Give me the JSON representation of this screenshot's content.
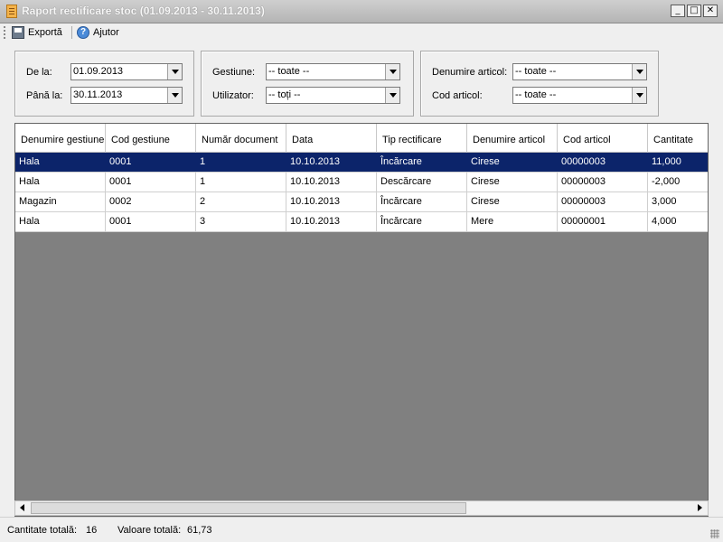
{
  "window": {
    "title": "Raport rectificare stoc (01.09.2013 - 30.11.2013)",
    "minimize_glyph": "_",
    "maximize_glyph": "□",
    "close_glyph": "✕"
  },
  "toolbar": {
    "export_label": "Exportă",
    "export_icon": "save-icon",
    "help_label": "Ajutor",
    "help_icon": "help-icon"
  },
  "filters": {
    "from_label": "De la:",
    "from_value": "01.09.2013",
    "to_label": "Până la:",
    "to_value": "30.11.2013",
    "gestiune_label": "Gestiune:",
    "gestiune_value": "-- toate --",
    "user_label": "Utilizator:",
    "user_value": "-- toți --",
    "article_name_label": "Denumire articol:",
    "article_name_value": "-- toate --",
    "article_code_label": "Cod articol:",
    "article_code_value": "-- toate --"
  },
  "grid": {
    "columns": [
      "Denumire gestiune",
      "Cod gestiune",
      "Număr document",
      "Data",
      "Tip rectificare",
      "Denumire articol",
      "Cod articol",
      "Cantitate"
    ],
    "rows": [
      [
        "Hala",
        "0001",
        "1",
        "10.10.2013",
        "Încărcare",
        "Cirese",
        "00000003",
        "11,000"
      ],
      [
        "Hala",
        "0001",
        "1",
        "10.10.2013",
        "Descărcare",
        "Cirese",
        "00000003",
        "-2,000"
      ],
      [
        "Magazin",
        "0002",
        "2",
        "10.10.2013",
        "Încărcare",
        "Cirese",
        "00000003",
        "3,000"
      ],
      [
        "Hala",
        "0001",
        "3",
        "10.10.2013",
        "Încărcare",
        "Mere",
        "00000001",
        "4,000"
      ]
    ],
    "selected_row": 0
  },
  "status": {
    "total_qty_label": "Cantitate totală:",
    "total_qty_value": "16",
    "total_value_label": "Valoare totală:",
    "total_value_value": "61,73"
  },
  "colors": {
    "selection": "#0c246a",
    "grid_background": "#808080",
    "window_background": "#efefef"
  }
}
